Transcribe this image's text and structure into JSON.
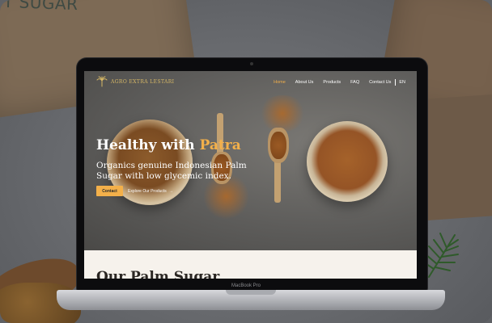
{
  "background": {
    "box_label": "NUT SUGAR"
  },
  "device": {
    "model_label": "MacBook Pro"
  },
  "site": {
    "brand": {
      "name": "AGRO EXTRA LESTARI",
      "color": "#d7b866"
    },
    "nav": {
      "items": [
        {
          "label": "Home",
          "active": true
        },
        {
          "label": "About Us",
          "active": false
        },
        {
          "label": "Products",
          "active": false
        },
        {
          "label": "FAQ",
          "active": false
        },
        {
          "label": "Contact Us",
          "active": false
        }
      ],
      "language": "EN"
    },
    "hero": {
      "title_prefix": "Healthy with",
      "title_accent": "Patra",
      "subtitle": "Organics genuine Indonesian Palm Sugar with low glycemic index.",
      "primary_button": "Contact",
      "secondary_button": "Explore Our Products",
      "secondary_arrow": "→"
    },
    "section": {
      "title": "Our Palm Sugar"
    },
    "colors": {
      "accent": "#f3b04a",
      "hero_text": "#ffffff",
      "section_bg": "#f6f2ec"
    }
  }
}
